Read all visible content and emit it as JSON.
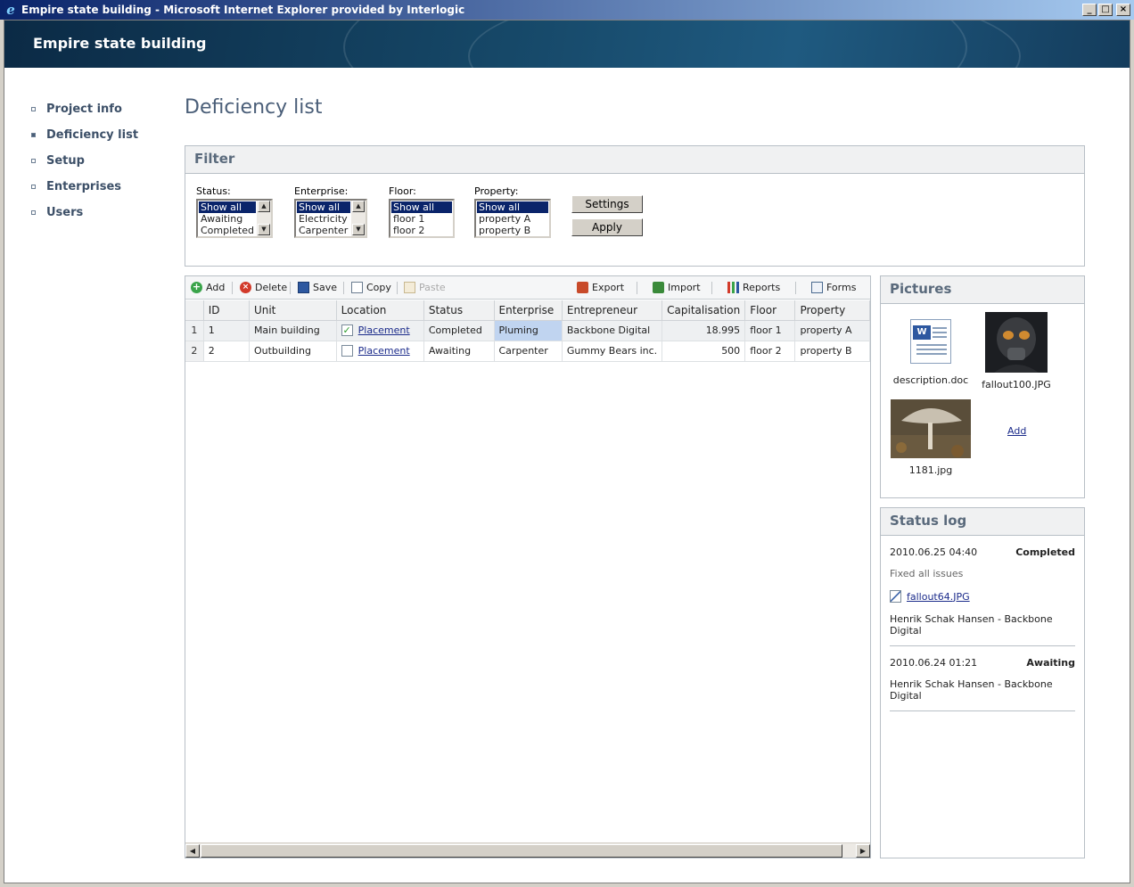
{
  "window": {
    "title": "Empire state building - Microsoft Internet Explorer provided by Interlogic",
    "minimize": "_",
    "maximize": "□",
    "close": "×"
  },
  "banner": {
    "title": "Empire state building"
  },
  "nav": {
    "items": [
      {
        "label": "Project info"
      },
      {
        "label": "Deficiency list"
      },
      {
        "label": "Setup"
      },
      {
        "label": "Enterprises"
      },
      {
        "label": "Users"
      }
    ]
  },
  "page": {
    "title": "Deficiency list"
  },
  "filter": {
    "heading": "Filter",
    "status": {
      "label": "Status:",
      "options": [
        "Show all",
        "Awaiting",
        "Completed"
      ]
    },
    "enterprise": {
      "label": "Enterprise:",
      "options": [
        "Show all",
        "Electricity",
        "Carpenter"
      ]
    },
    "floor": {
      "label": "Floor:",
      "options": [
        "Show all",
        "floor 1",
        "floor 2"
      ]
    },
    "property": {
      "label": "Property:",
      "options": [
        "Show all",
        "property A",
        "property B"
      ]
    },
    "settings_label": "Settings",
    "apply_label": "Apply"
  },
  "toolbar": {
    "add": "Add",
    "delete": "Delete",
    "save": "Save",
    "copy": "Copy",
    "paste": "Paste",
    "export": "Export",
    "import": "Import",
    "reports": "Reports",
    "forms": "Forms"
  },
  "grid": {
    "columns": [
      "ID",
      "Unit",
      "Location",
      "Status",
      "Enterprise",
      "Entrepreneur",
      "Capitalisation",
      "Floor",
      "Property"
    ],
    "rows": [
      {
        "rownum": "1",
        "id": "1",
        "unit": "Main building",
        "location_checked": true,
        "location": "Placement",
        "status": "Completed",
        "enterprise": "Pluming",
        "entrepreneur": "Backbone Digital",
        "capitalisation": "18.995",
        "floor": "floor 1",
        "property": "property A"
      },
      {
        "rownum": "2",
        "id": "2",
        "unit": "Outbuilding",
        "location_checked": false,
        "location": "Placement",
        "status": "Awaiting",
        "enterprise": "Carpenter",
        "entrepreneur": "Gummy Bears inc.",
        "capitalisation": "500",
        "floor": "floor 2",
        "property": "property B"
      }
    ]
  },
  "pictures": {
    "heading": "Pictures",
    "items": [
      {
        "caption": "description.doc",
        "icon": "word-document-icon"
      },
      {
        "caption": "fallout100.JPG"
      },
      {
        "caption": "1181.jpg"
      }
    ],
    "add_label": "Add"
  },
  "status_log": {
    "heading": "Status log",
    "entries": [
      {
        "timestamp": "2010.06.25 04:40",
        "status": "Completed",
        "comment": "Fixed all issues",
        "file": "fallout64.JPG",
        "author": "Henrik Schak Hansen - Backbone Digital"
      },
      {
        "timestamp": "2010.06.24 01:21",
        "status": "Awaiting",
        "author": "Henrik Schak Hansen - Backbone Digital"
      }
    ]
  }
}
